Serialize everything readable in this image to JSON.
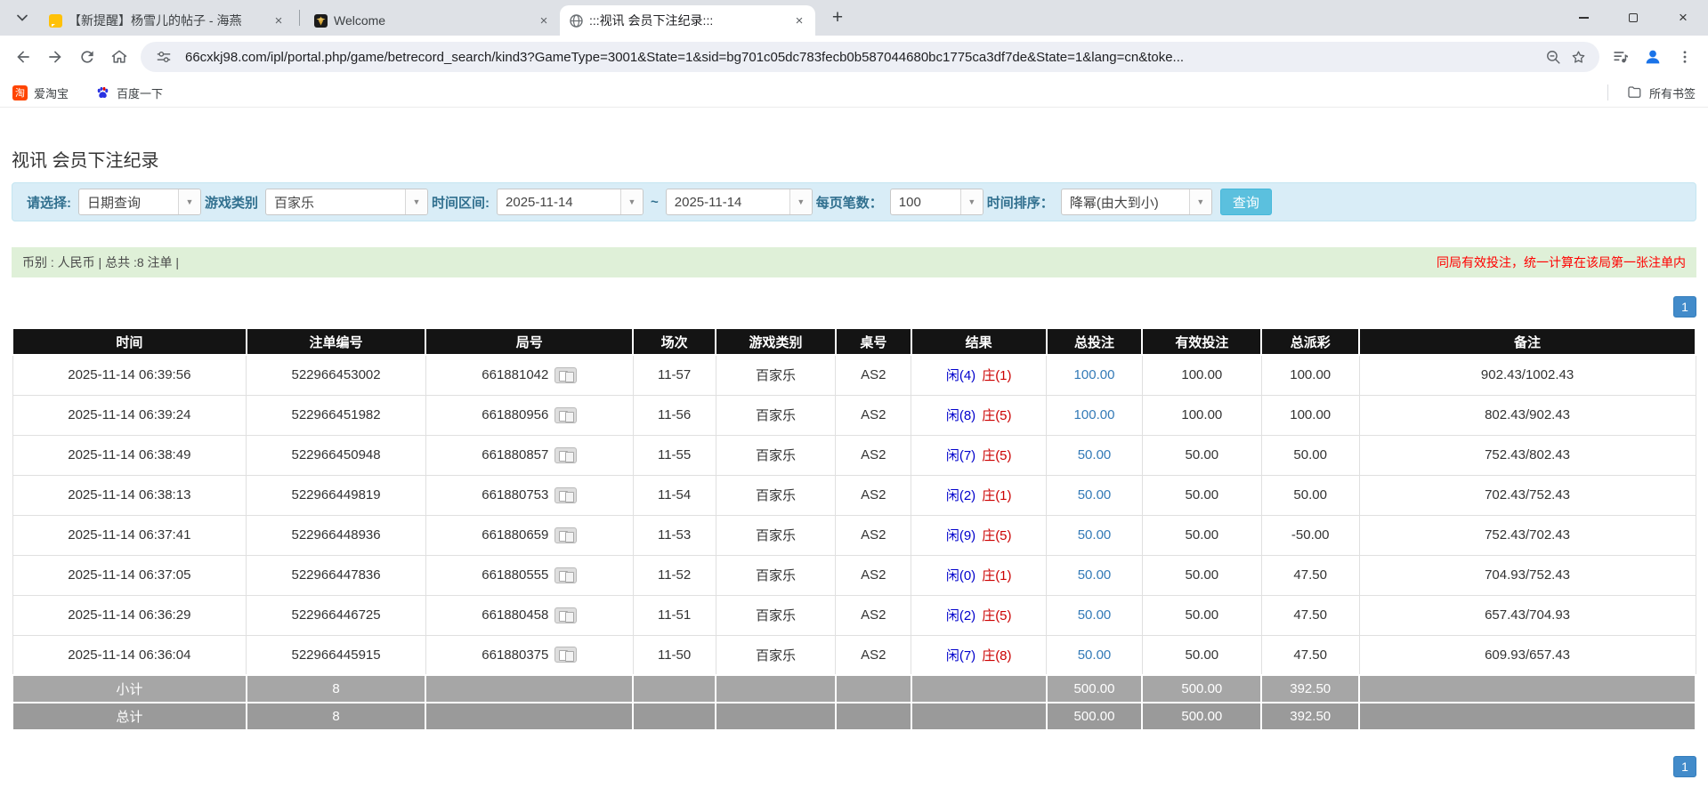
{
  "browser": {
    "tabs": [
      {
        "title": "【新提醒】杨雪儿的帖子 - 海燕",
        "active": false
      },
      {
        "title": "Welcome",
        "active": false
      },
      {
        "title": ":::视讯 会员下注纪录:::",
        "active": true
      }
    ],
    "new_tab_label": "+",
    "close_glyph": "×",
    "url": "66cxkj98.com/ipl/portal.php/game/betrecord_search/kind3?GameType=3001&State=1&sid=bg701c05dc783fecb0b587044680bc1775ca3df7de&State=1&lang=cn&toke...",
    "bookmarks": {
      "item1": "爱淘宝",
      "item2": "百度一下",
      "all_bookmarks": "所有书签",
      "tao_glyph": "淘"
    }
  },
  "page": {
    "title": "视讯 会员下注纪录",
    "filter": {
      "select_label": "请选择:",
      "select_value": "日期查询",
      "game_type_label": "游戏类别",
      "game_type_value": "百家乐",
      "date_range_label": "时间区间:",
      "date_from": "2025-11-14",
      "tilde": "~",
      "date_to": "2025-11-14",
      "page_size_label": "每页笔数：",
      "page_size_value": "100",
      "sort_label": "时间排序：",
      "sort_value": "降幂(由大到小)",
      "search_button": "查询",
      "arrow_glyph": "▼"
    },
    "info_bar": {
      "left": "币别 : 人民币 | 总共 :8 注单 |",
      "right": "同局有效投注，统一计算在该局第一张注单内"
    },
    "pagination": {
      "page": "1"
    },
    "table": {
      "headers": [
        "时间",
        "注单编号",
        "局号",
        "场次",
        "游戏类别",
        "桌号",
        "结果",
        "总投注",
        "有效投注",
        "总派彩",
        "备注"
      ],
      "rows": [
        {
          "time": "2025-11-14 06:39:56",
          "bet_id": "522966453002",
          "round_id": "661881042",
          "session": "11-57",
          "game": "百家乐",
          "table_no": "AS2",
          "result_player": "闲(4)",
          "result_banker": "庄(1)",
          "total_bet": "100.00",
          "valid_bet": "100.00",
          "payout": "100.00",
          "remark": "902.43/1002.43"
        },
        {
          "time": "2025-11-14 06:39:24",
          "bet_id": "522966451982",
          "round_id": "661880956",
          "session": "11-56",
          "game": "百家乐",
          "table_no": "AS2",
          "result_player": "闲(8)",
          "result_banker": "庄(5)",
          "total_bet": "100.00",
          "valid_bet": "100.00",
          "payout": "100.00",
          "remark": "802.43/902.43"
        },
        {
          "time": "2025-11-14 06:38:49",
          "bet_id": "522966450948",
          "round_id": "661880857",
          "session": "11-55",
          "game": "百家乐",
          "table_no": "AS2",
          "result_player": "闲(7)",
          "result_banker": "庄(5)",
          "total_bet": "50.00",
          "valid_bet": "50.00",
          "payout": "50.00",
          "remark": "752.43/802.43"
        },
        {
          "time": "2025-11-14 06:38:13",
          "bet_id": "522966449819",
          "round_id": "661880753",
          "session": "11-54",
          "game": "百家乐",
          "table_no": "AS2",
          "result_player": "闲(2)",
          "result_banker": "庄(1)",
          "total_bet": "50.00",
          "valid_bet": "50.00",
          "payout": "50.00",
          "remark": "702.43/752.43"
        },
        {
          "time": "2025-11-14 06:37:41",
          "bet_id": "522966448936",
          "round_id": "661880659",
          "session": "11-53",
          "game": "百家乐",
          "table_no": "AS2",
          "result_player": "闲(9)",
          "result_banker": "庄(5)",
          "total_bet": "50.00",
          "valid_bet": "50.00",
          "payout": "-50.00",
          "remark": "752.43/702.43"
        },
        {
          "time": "2025-11-14 06:37:05",
          "bet_id": "522966447836",
          "round_id": "661880555",
          "session": "11-52",
          "game": "百家乐",
          "table_no": "AS2",
          "result_player": "闲(0)",
          "result_banker": "庄(1)",
          "total_bet": "50.00",
          "valid_bet": "50.00",
          "payout": "47.50",
          "remark": "704.93/752.43"
        },
        {
          "time": "2025-11-14 06:36:29",
          "bet_id": "522966446725",
          "round_id": "661880458",
          "session": "11-51",
          "game": "百家乐",
          "table_no": "AS2",
          "result_player": "闲(2)",
          "result_banker": "庄(5)",
          "total_bet": "50.00",
          "valid_bet": "50.00",
          "payout": "47.50",
          "remark": "657.43/704.93"
        },
        {
          "time": "2025-11-14 06:36:04",
          "bet_id": "522966445915",
          "round_id": "661880375",
          "session": "11-50",
          "game": "百家乐",
          "table_no": "AS2",
          "result_player": "闲(7)",
          "result_banker": "庄(8)",
          "total_bet": "50.00",
          "valid_bet": "50.00",
          "payout": "47.50",
          "remark": "609.93/657.43"
        }
      ],
      "subtotal": {
        "label": "小计",
        "count": "8",
        "total_bet": "500.00",
        "valid_bet": "500.00",
        "payout": "392.50"
      },
      "total": {
        "label": "总计",
        "count": "8",
        "total_bet": "500.00",
        "valid_bet": "500.00",
        "payout": "392.50"
      }
    },
    "colors": {
      "filter_bg": "#d9edf7",
      "info_bg": "#dff0d8",
      "button_cyan": "#5bc0de",
      "pagination_blue": "#428bca",
      "player_blue": "#0000cc",
      "banker_red": "#cc0000",
      "negative_red": "#ff0000",
      "link_blue": "#337ab7"
    }
  }
}
